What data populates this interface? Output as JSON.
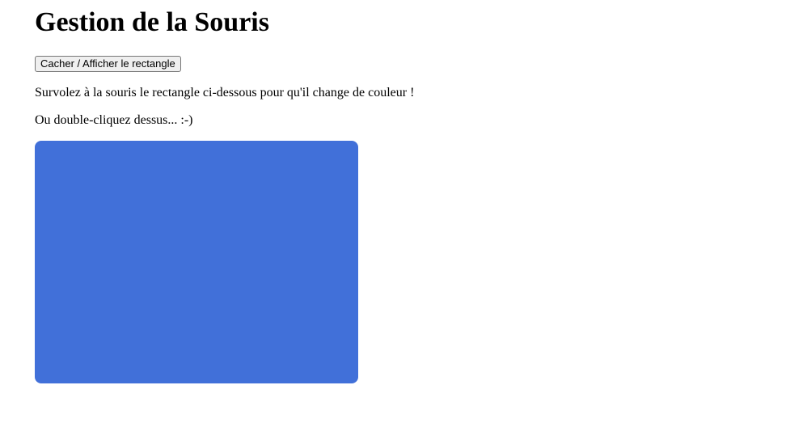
{
  "page": {
    "title": "Gestion de la Souris",
    "toggle_button_label": "Cacher / Afficher le rectangle",
    "hover_instruction": "Survolez à la souris le rectangle ci-dessous pour qu'il change de couleur !",
    "dblclick_instruction": "Ou double-cliquez dessus... :-)"
  },
  "rectangle": {
    "color": "#4170d9"
  }
}
